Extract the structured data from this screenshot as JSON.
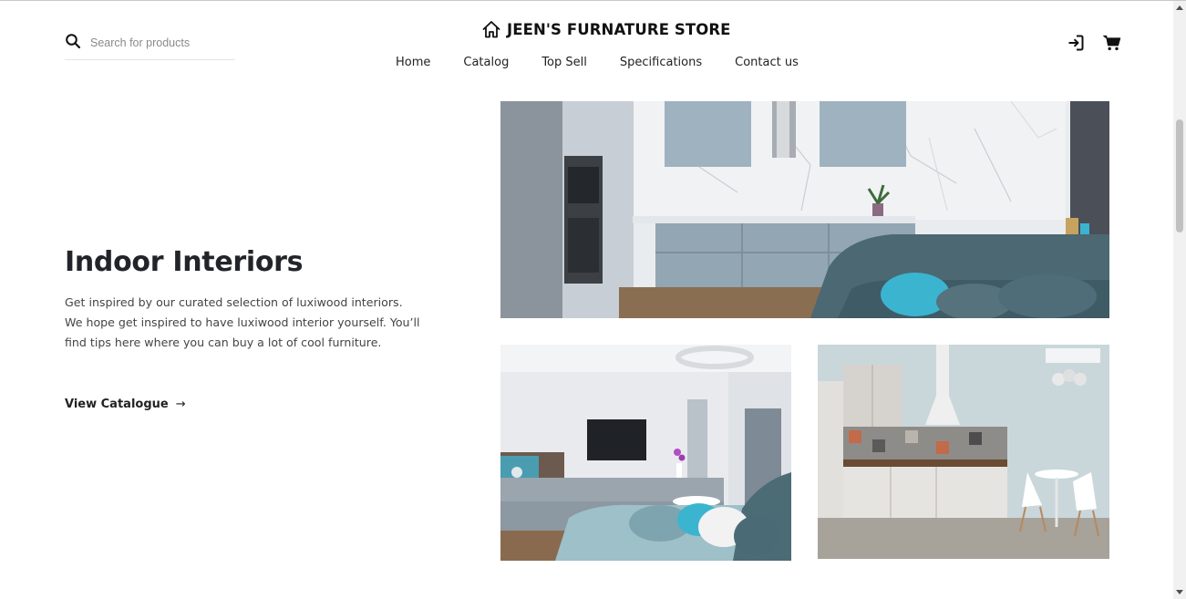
{
  "header": {
    "search": {
      "placeholder": "Search for products",
      "value": ""
    },
    "brand": {
      "name": "JEEN'S FURNATURE STORE",
      "icon": "house-icon"
    },
    "nav": [
      {
        "label": "Home"
      },
      {
        "label": "Catalog"
      },
      {
        "label": "Top Sell"
      },
      {
        "label": "Specifications"
      },
      {
        "label": "Contact us"
      }
    ],
    "actions": {
      "login_icon": "sign-in-icon",
      "cart_icon": "cart-icon"
    }
  },
  "hero": {
    "title": "Indoor Interiors",
    "description": "Get inspired by our curated selection of luxiwood interiors. We hope get inspired to have luxiwood interior yourself. You’ll find tips here where you can buy a lot of cool furniture.",
    "cta_label": "View Catalogue",
    "cta_arrow": "→"
  },
  "gallery": [
    {
      "subject": "kitchen-and-sofa-photo"
    },
    {
      "subject": "living-room-photo"
    },
    {
      "subject": "kitchen-dining-photo"
    }
  ],
  "colors": {
    "text": "#212529",
    "wall_blue": "#c9d4dc",
    "cabinet_blue": "#8da3b1",
    "sofa_teal": "#4b6873",
    "pillow_cyan": "#3bb4d0",
    "floor_wood": "#8a6e52"
  }
}
